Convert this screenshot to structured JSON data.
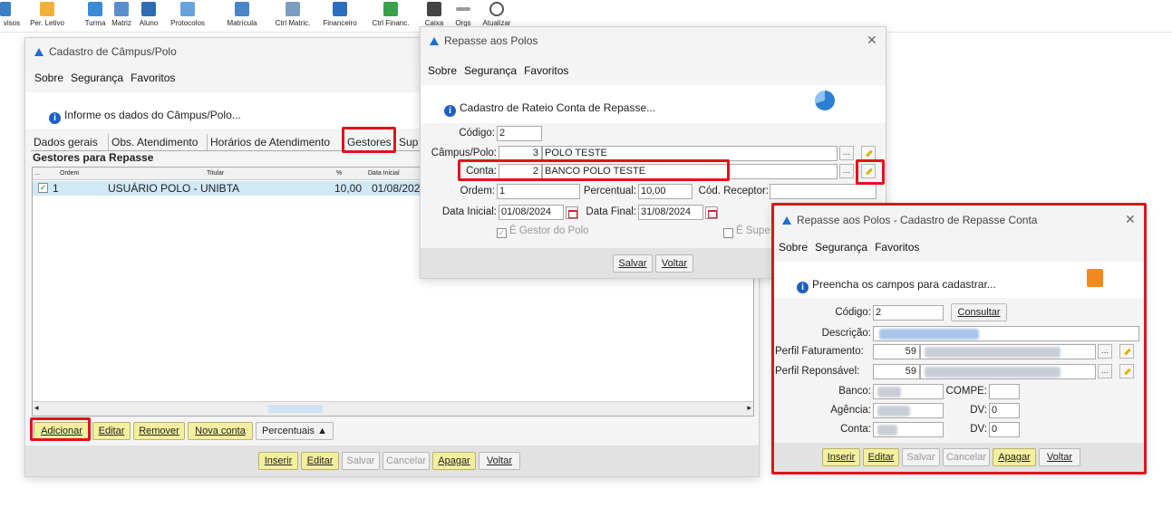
{
  "toolbar": {
    "items": [
      "visos",
      "Per. Letivo",
      "Turma",
      "Matriz",
      "Aluno",
      "Protocolos",
      "Matrícula",
      "Ctrl Matric.",
      "Financeiro",
      "Ctrl Financ.",
      "Caixa",
      "Orgs",
      "Atualizar"
    ]
  },
  "campus_window": {
    "title": "Cadastro de Câmpus/Polo",
    "menu": [
      "Sobre",
      "Segurança",
      "Favoritos"
    ],
    "info": "Informe os dados do Câmpus/Polo...",
    "tabs": [
      "Dados gerais",
      "Obs. Atendimento",
      "Horários de Atendimento",
      "Gestores",
      "Sup"
    ],
    "group_title": "Gestores para Repasse",
    "columns": [
      "...",
      "Ordem",
      "Titular",
      "%",
      "Data Inicial"
    ],
    "rows": [
      {
        "ordem": "1",
        "titular": "USUÁRIO POLO - UNIBTA",
        "pct": "10,00",
        "data": "01/08/202"
      }
    ],
    "list_buttons": [
      "Adicionar",
      "Editar",
      "Remover",
      "Nova conta",
      "Percentuais ▲"
    ],
    "bottom_buttons": [
      "Inserir",
      "Editar",
      "Salvar",
      "Cancelar",
      "Apagar",
      "Voltar"
    ]
  },
  "repasse_window": {
    "title": "Repasse aos Polos",
    "menu": [
      "Sobre",
      "Segurança",
      "Favoritos"
    ],
    "info": "Cadastro de Rateio Conta de Repasse...",
    "labels": {
      "codigo": "Código:",
      "campus": "Câmpus/Polo:",
      "conta": "Conta:",
      "ordem": "Ordem:",
      "percentual": "Percentual:",
      "cod_receptor": "Cód. Receptor:",
      "data_inicial": "Data Inicial:",
      "data_final": "Data Final:"
    },
    "values": {
      "codigo": "2",
      "campus_id": "3",
      "campus_name": "POLO TESTE",
      "conta_id": "2",
      "conta_name": "BANCO POLO TESTE",
      "ordem": "1",
      "percentual": "10,00",
      "cod_receptor": "",
      "data_inicial": "01/08/2024",
      "data_final": "31/08/2024"
    },
    "checks": {
      "gestor": "É Gestor do Polo",
      "super": "É Supe"
    },
    "buttons": [
      "Salvar",
      "Voltar"
    ]
  },
  "conta_window": {
    "title": "Repasse aos Polos - Cadastro de Repasse Conta",
    "menu": [
      "Sobre",
      "Segurança",
      "Favoritos"
    ],
    "info": "Preencha os campos para cadastrar...",
    "labels": {
      "codigo": "Código:",
      "descricao": "Descrição:",
      "perfil_fat": "Perfil Faturamento:",
      "perfil_resp": "Perfil Reponsável:",
      "banco": "Banco:",
      "compe": "COMPE:",
      "agencia": "Agência:",
      "dv1": "DV:",
      "conta": "Conta:",
      "dv2": "DV:"
    },
    "values": {
      "codigo": "2",
      "perfil_fat": "59",
      "perfil_resp": "59",
      "dv1": "0",
      "dv2": "0"
    },
    "consultar": "Consultar",
    "buttons": [
      "Inserir",
      "Editar",
      "Salvar",
      "Cancelar",
      "Apagar",
      "Voltar"
    ]
  },
  "colors": {
    "highlight": "#e0131c",
    "selected_row": "#cfe9f7",
    "yellow_button": "#f3ef9e",
    "info_icon": "#1e5fbf"
  }
}
